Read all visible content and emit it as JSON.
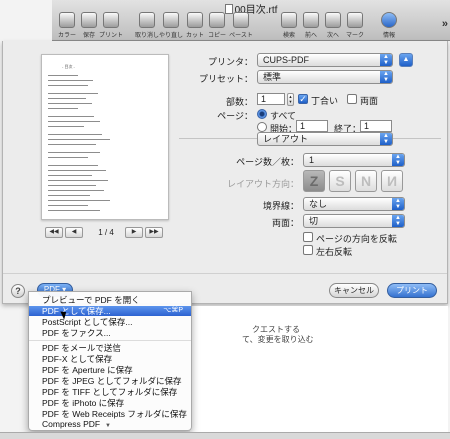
{
  "window": {
    "title": "00目次.rtf"
  },
  "toolbar": {
    "buttons": [
      {
        "label": "カラー",
        "icon": "color-icon"
      },
      {
        "label": "保存",
        "icon": "save-icon"
      },
      {
        "label": "プリント",
        "icon": "print-icon"
      },
      {
        "label": "取り消し",
        "icon": "undo-icon"
      },
      {
        "label": "やり直し",
        "icon": "redo-icon"
      },
      {
        "label": "カット",
        "icon": "scissors-icon"
      },
      {
        "label": "コピー",
        "icon": "copy-icon"
      },
      {
        "label": "ペースト",
        "icon": "paste-icon"
      },
      {
        "label": "検索",
        "icon": "search-icon"
      },
      {
        "label": "前へ",
        "icon": "previous-icon"
      },
      {
        "label": "次へ",
        "icon": "next-icon"
      },
      {
        "label": "マーク",
        "icon": "mark-icon"
      },
      {
        "label": "情報",
        "icon": "info-icon"
      }
    ],
    "more": "»"
  },
  "preview": {
    "heading": "- 目次 -",
    "page_indicator": "1 / 4",
    "nav": {
      "first": "◀◀",
      "prev": "◀",
      "next": "▶",
      "last": "▶▶"
    }
  },
  "printer": {
    "label": "プリンタ：",
    "value": "CUPS-PDF"
  },
  "preset": {
    "label": "プリセット：",
    "value": "標準"
  },
  "copies": {
    "label": "部数：",
    "value": "1",
    "collate_label": "丁合い",
    "duplex_label": "両面"
  },
  "pages": {
    "label": "ページ：",
    "all_label": "すべて",
    "from_label": "開始：",
    "from_value": "1",
    "to_label": "終了：",
    "to_value": "1"
  },
  "section": {
    "value": "レイアウト"
  },
  "layout": {
    "pages_per_sheet_label": "ページ数／枚：",
    "pages_per_sheet_value": "1",
    "direction_label": "レイアウト方向：",
    "border_label": "境界線：",
    "border_value": "なし",
    "duplex_label": "両面：",
    "duplex_value": "切",
    "reverse_orientation_label": "ページの方向を反転",
    "flip_horizontal_label": "左右反転"
  },
  "footer": {
    "help": "?",
    "pdf_label": "PDF ▾",
    "cancel_label": "キャンセル",
    "print_label": "プリント"
  },
  "pdf_menu": {
    "items": [
      {
        "label": "プレビューで PDF を開く",
        "shortcut": ""
      },
      {
        "label": "PDF として保存...",
        "shortcut": "⌥⌘P"
      },
      {
        "label": "PostScript として保存...",
        "shortcut": ""
      },
      {
        "label": "PDF をファクス...",
        "shortcut": ""
      },
      {
        "label": "PDF をメールで送信",
        "shortcut": ""
      },
      {
        "label": "PDF-X として保存",
        "shortcut": ""
      },
      {
        "label": "PDF を Aperture に保存",
        "shortcut": ""
      },
      {
        "label": "PDF を JPEG としてフォルダに保存",
        "shortcut": ""
      },
      {
        "label": "PDF を TIFF としてフォルダに保存",
        "shortcut": ""
      },
      {
        "label": "PDF を iPhoto に保存",
        "shortcut": ""
      },
      {
        "label": "PDF を Web Receipts フォルダに保存",
        "shortcut": ""
      },
      {
        "label": "Compress PDF",
        "shortcut": ""
      }
    ]
  },
  "document_behind": {
    "line1": "クエストする",
    "line2": "て、変更を取り込む"
  },
  "colors": {
    "accent": "#2d63d1",
    "sheet": "#ececec"
  }
}
